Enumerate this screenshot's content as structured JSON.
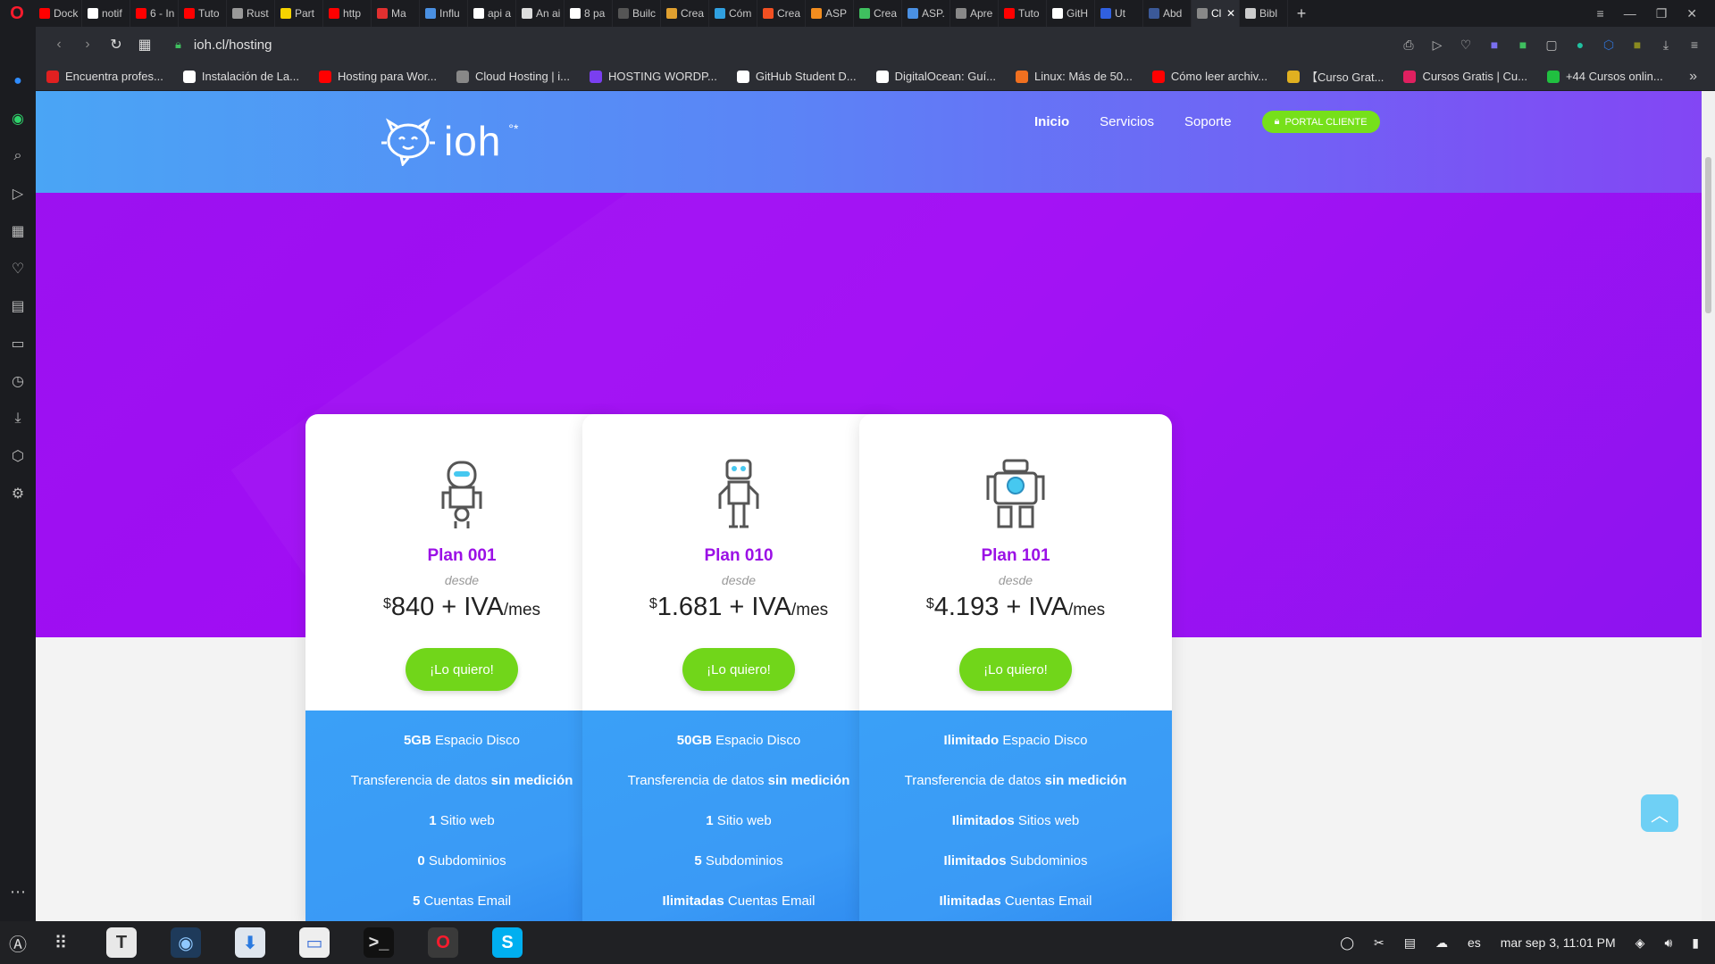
{
  "browser": {
    "tabs": [
      {
        "label": "Dock",
        "color": "#ff0000"
      },
      {
        "label": "notif",
        "color": "#ffffff"
      },
      {
        "label": "6 - In",
        "color": "#ff0000"
      },
      {
        "label": "Tuto",
        "color": "#ff0000"
      },
      {
        "label": "Rust",
        "color": "#999999"
      },
      {
        "label": "Part",
        "color": "#f5d300"
      },
      {
        "label": "http",
        "color": "#ff0000"
      },
      {
        "label": "Ma",
        "color": "#e03030"
      },
      {
        "label": "Influ",
        "color": "#4a90e2"
      },
      {
        "label": "api a",
        "color": "#ffffff"
      },
      {
        "label": "An ai",
        "color": "#dddddd"
      },
      {
        "label": "8 pa",
        "color": "#ffffff"
      },
      {
        "label": "Builc",
        "color": "#555555"
      },
      {
        "label": "Crea",
        "color": "#e0a030"
      },
      {
        "label": "Cóm",
        "color": "#30a0e0"
      },
      {
        "label": "Crea",
        "color": "#f25022"
      },
      {
        "label": "ASP",
        "color": "#f28d1f"
      },
      {
        "label": "Crea",
        "color": "#3fbf5f"
      },
      {
        "label": "ASP.",
        "color": "#4a90e2"
      },
      {
        "label": "Apre",
        "color": "#888888"
      },
      {
        "label": "Tuto",
        "color": "#ff0000"
      },
      {
        "label": "GitH",
        "color": "#ffffff"
      },
      {
        "label": "Ut",
        "color": "#3060e0"
      },
      {
        "label": "Abd",
        "color": "#3b5998"
      },
      {
        "label": "Cl",
        "color": "#888888",
        "active": true
      },
      {
        "label": "Bibl",
        "color": "#cccccc"
      }
    ],
    "url": "ioh.cl/hosting",
    "bookmarks": [
      {
        "label": "Encuentra profes...",
        "color": "#e02020"
      },
      {
        "label": "Instalación de La...",
        "color": "#ffffff"
      },
      {
        "label": "Hosting para Wor...",
        "color": "#ff0000"
      },
      {
        "label": "Cloud Hosting | i...",
        "color": "#888888"
      },
      {
        "label": "HOSTING WORDP...",
        "color": "#7a3ff0"
      },
      {
        "label": "GitHub Student D...",
        "color": "#ffffff"
      },
      {
        "label": "DigitalOcean: Guí...",
        "color": "#ffffff"
      },
      {
        "label": "Linux: Más de 50...",
        "color": "#f07020"
      },
      {
        "label": "Cómo leer archiv...",
        "color": "#ff0000"
      },
      {
        "label": "【Curso Grat...",
        "color": "#e0b020"
      },
      {
        "label": "Cursos Gratis | Cu...",
        "color": "#e02060"
      },
      {
        "label": "+44 Cursos onlin...",
        "color": "#20c040"
      }
    ]
  },
  "site": {
    "logo": "ioh",
    "nav": {
      "inicio": "Inicio",
      "servicios": "Servicios",
      "soporte": "Soporte",
      "portal": "PORTAL CLIENTE"
    },
    "plans": [
      {
        "name": "Plan 001",
        "desde": "desde",
        "currency": "$",
        "price": "840 + IVA",
        "unit": "/mes",
        "cta": "¡Lo quiero!",
        "features": [
          {
            "bold": "5GB",
            "text": " Espacio Disco"
          },
          {
            "pre": "Transferencia de datos ",
            "bold": "sin medición"
          },
          {
            "bold": "1",
            "text": " Sitio web"
          },
          {
            "bold": "0",
            "text": " Subdominios"
          },
          {
            "bold": "5",
            "text": " Cuentas Email"
          }
        ]
      },
      {
        "name": "Plan 010",
        "desde": "desde",
        "currency": "$",
        "price": "1.681 + IVA",
        "unit": "/mes",
        "cta": "¡Lo quiero!",
        "features": [
          {
            "bold": "50GB",
            "text": " Espacio Disco"
          },
          {
            "pre": "Transferencia de datos ",
            "bold": "sin medición"
          },
          {
            "bold": "1",
            "text": " Sitio web"
          },
          {
            "bold": "5",
            "text": " Subdominios"
          },
          {
            "bold": "Ilimitadas",
            "text": " Cuentas Email"
          }
        ]
      },
      {
        "name": "Plan 101",
        "desde": "desde",
        "currency": "$",
        "price": "4.193 + IVA",
        "unit": "/mes",
        "cta": "¡Lo quiero!",
        "features": [
          {
            "bold": "Ilimitado",
            "text": " Espacio Disco"
          },
          {
            "pre": "Transferencia de datos ",
            "bold": "sin medición"
          },
          {
            "bold": "Ilimitados",
            "text": " Sitios web"
          },
          {
            "bold": "Ilimitados",
            "text": " Subdominios"
          },
          {
            "bold": "Ilimitadas",
            "text": " Cuentas Email"
          }
        ]
      }
    ]
  },
  "taskbar": {
    "apps": [
      {
        "name": "typora",
        "glyph": "T",
        "bg": "#e8e8e8",
        "fg": "#333333"
      },
      {
        "name": "globe",
        "glyph": "◉",
        "bg": "#1e3a5a",
        "fg": "#8fc8ff"
      },
      {
        "name": "downloader",
        "glyph": "⬇",
        "bg": "#dfe6ee",
        "fg": "#2a7ae0"
      },
      {
        "name": "files",
        "glyph": "▭",
        "bg": "#eeeeee",
        "fg": "#3a6fd8"
      },
      {
        "name": "terminal",
        "glyph": ">_",
        "bg": "#111111",
        "fg": "#dddddd"
      },
      {
        "name": "opera",
        "glyph": "O",
        "bg": "#3a3a3a",
        "fg": "#ff1b2d"
      },
      {
        "name": "skype",
        "glyph": "S",
        "bg": "#00aff0",
        "fg": "#ffffff"
      }
    ],
    "lang": "es",
    "clock": "mar sep 3, 11:01 PM"
  }
}
